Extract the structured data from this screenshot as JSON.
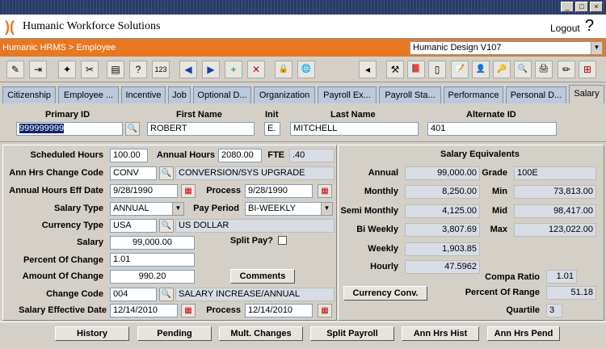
{
  "app": {
    "name": "Humanic Workforce Solutions",
    "logout": "Logout",
    "help": "?",
    "breadcrumb": "Humanic HRMS > Employee",
    "design_select": "Humanic Design V107"
  },
  "toolbar": {
    "icons": [
      "note-icon",
      "exit-icon",
      "pin-icon",
      "clear-icon",
      "table-icon",
      "help-table-icon",
      "numbers-icon",
      "prev-icon",
      "next-icon",
      "add-record-icon",
      "delete-record-icon",
      "lock-icon",
      "globe-icon",
      "back-icon",
      "tools-icon",
      "book-icon",
      "page-icon",
      "memo-icon",
      "user-photo-icon",
      "key-icon",
      "search-record-icon",
      "print-icon",
      "pencil-icon",
      "org-chart-icon"
    ],
    "glyphs": [
      "✎",
      "⇥",
      "✦",
      "✂",
      "▤",
      "?",
      "123",
      "◀",
      "▶",
      "+",
      "✕",
      "🔒",
      "🌐",
      "◂",
      "⚒",
      "📕",
      "▯",
      "📝",
      "👤",
      "🔑",
      "🔍",
      "🖨",
      "✏",
      "⊞"
    ]
  },
  "tabs": [
    "Citizenship",
    "Employee ...",
    "Incentive",
    "Job",
    "Optional D...",
    "Organization",
    "Payroll Ex...",
    "Payroll Sta...",
    "Performance",
    "Personal D...",
    "Salary"
  ],
  "identity": {
    "primary_id_label": "Primary ID",
    "primary_id": "999999999",
    "first_name_label": "First Name",
    "first_name": "ROBERT",
    "init_label": "Init",
    "init": "E.",
    "last_name_label": "Last Name",
    "last_name": "MITCHELL",
    "alternate_id_label": "Alternate ID",
    "alternate_id": "401"
  },
  "left": {
    "scheduled_hours_label": "Scheduled Hours",
    "scheduled_hours": "100.00",
    "annual_hours_label": "Annual Hours",
    "annual_hours": "2080.00",
    "fte_label": "FTE",
    "fte": ".40",
    "ann_hrs_change_code_label": "Ann Hrs Change Code",
    "ann_hrs_change_code": "CONV",
    "ann_hrs_change_desc": "CONVERSION/SYS UPGRADE",
    "annual_hours_eff_date_label": "Annual Hours Eff Date",
    "annual_hours_eff_date": "9/28/1990",
    "process_label": "Process",
    "process_date": "9/28/1990",
    "salary_type_label": "Salary Type",
    "salary_type": "ANNUAL",
    "pay_period_label": "Pay Period",
    "pay_period": "BI-WEEKLY",
    "currency_type_label": "Currency Type",
    "currency_type": "USA",
    "currency_desc": "US DOLLAR",
    "salary_label": "Salary",
    "salary": "99,000.00",
    "split_pay_label": "Split Pay?",
    "percent_of_change_label": "Percent Of Change",
    "percent_of_change": "1.01",
    "amount_of_change_label": "Amount Of Change",
    "amount_of_change": "990.20",
    "comments_button": "Comments",
    "change_code_label": "Change Code",
    "change_code": "004",
    "change_code_desc": "SALARY INCREASE/ANNUAL",
    "salary_effective_date_label": "Salary Effective Date",
    "salary_effective_date": "12/14/2010",
    "process_label_2": "Process",
    "process_date_2": "12/14/2010"
  },
  "right": {
    "title": "Salary Equivalents",
    "annual_label": "Annual",
    "annual": "99,000.00",
    "grade_label": "Grade",
    "grade": "100E",
    "monthly_label": "Monthly",
    "monthly": "8,250.00",
    "min_label": "Min",
    "min": "73,813.00",
    "semi_monthly_label": "Semi Monthly",
    "semi_monthly": "4,125.00",
    "mid_label": "Mid",
    "mid": "98,417.00",
    "bi_weekly_label": "Bi Weekly",
    "bi_weekly": "3,807.69",
    "max_label": "Max",
    "max": "123,022.00",
    "weekly_label": "Weekly",
    "weekly": "1,903.85",
    "hourly_label": "Hourly",
    "hourly": "47.5962",
    "compa_ratio_label": "Compa Ratio",
    "compa_ratio": "1.01",
    "currency_conv_button": "Currency Conv.",
    "percent_of_range_label": "Percent Of Range",
    "percent_of_range": "51.18",
    "quartile_label": "Quartile",
    "quartile": "3"
  },
  "bottom_buttons": [
    "History",
    "Pending",
    "Mult. Changes",
    "Split Payroll",
    "Ann Hrs Hist",
    "Ann Hrs Pend"
  ]
}
